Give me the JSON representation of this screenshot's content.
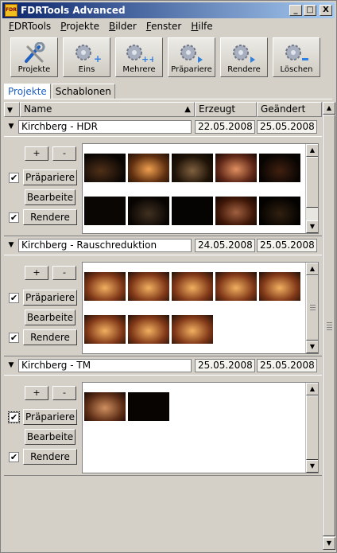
{
  "window": {
    "title": "FDRTools Advanced",
    "icon_text": "FDR"
  },
  "title_buttons": {
    "minimize": "_",
    "maximize": "□",
    "close": "X"
  },
  "menu": [
    {
      "label": "FDRTools",
      "underline": "F",
      "rest": "DRTools"
    },
    {
      "label": "Projekte",
      "underline": "P",
      "rest": "rojekte"
    },
    {
      "label": "Bilder",
      "underline": "B",
      "rest": "ilder"
    },
    {
      "label": "Fenster",
      "underline": "F",
      "rest": "enster"
    },
    {
      "label": "Hilfe",
      "underline": "H",
      "rest": "ilfe"
    }
  ],
  "toolbar": [
    {
      "label": "Projekte",
      "icon": "wrench-screwdriver-icon"
    },
    {
      "label": "Eins",
      "icon": "gear-plus-icon"
    },
    {
      "label": "Mehrere",
      "icon": "gear-plus-plus-icon"
    },
    {
      "label": "Präpariere",
      "icon": "gear-arrow-icon"
    },
    {
      "label": "Rendere",
      "icon": "gear-arrow-icon"
    },
    {
      "label": "Löschen",
      "icon": "gear-minus-icon"
    }
  ],
  "tabs": [
    {
      "label": "Projekte",
      "active": true
    },
    {
      "label": "Schablonen",
      "active": false
    }
  ],
  "table_header": {
    "name": "Name",
    "created": "Erzeugt",
    "modified": "Geändert"
  },
  "colors": {
    "accent": "#0a246a",
    "tab_active_text": "#1f5fbf"
  },
  "projects": [
    {
      "name": "Kirchberg - HDR",
      "created": "22.05.2008",
      "modified": "25.05.2008",
      "plus": "+",
      "minus": "-",
      "prepare_label": "Präpariere",
      "prepare_checked": true,
      "edit_label": "Bearbeite",
      "render_label": "Rendere",
      "render_checked": true,
      "thumbnail_count": 10
    },
    {
      "name": "Kirchberg - Rauschreduktion",
      "created": "24.05.2008",
      "modified": "25.05.2008",
      "plus": "+",
      "minus": "-",
      "prepare_label": "Präpariere",
      "prepare_checked": true,
      "edit_label": "Bearbeite",
      "render_label": "Rendere",
      "render_checked": true,
      "thumbnail_count": 8
    },
    {
      "name": "Kirchberg - TM",
      "created": "25.05.2008",
      "modified": "25.05.2008",
      "plus": "+",
      "minus": "-",
      "prepare_label": "Präpariere",
      "prepare_checked": true,
      "edit_label": "Bearbeite",
      "render_label": "Rendere",
      "render_checked": true,
      "thumbnail_count": 2
    }
  ],
  "checkmark": "✔"
}
